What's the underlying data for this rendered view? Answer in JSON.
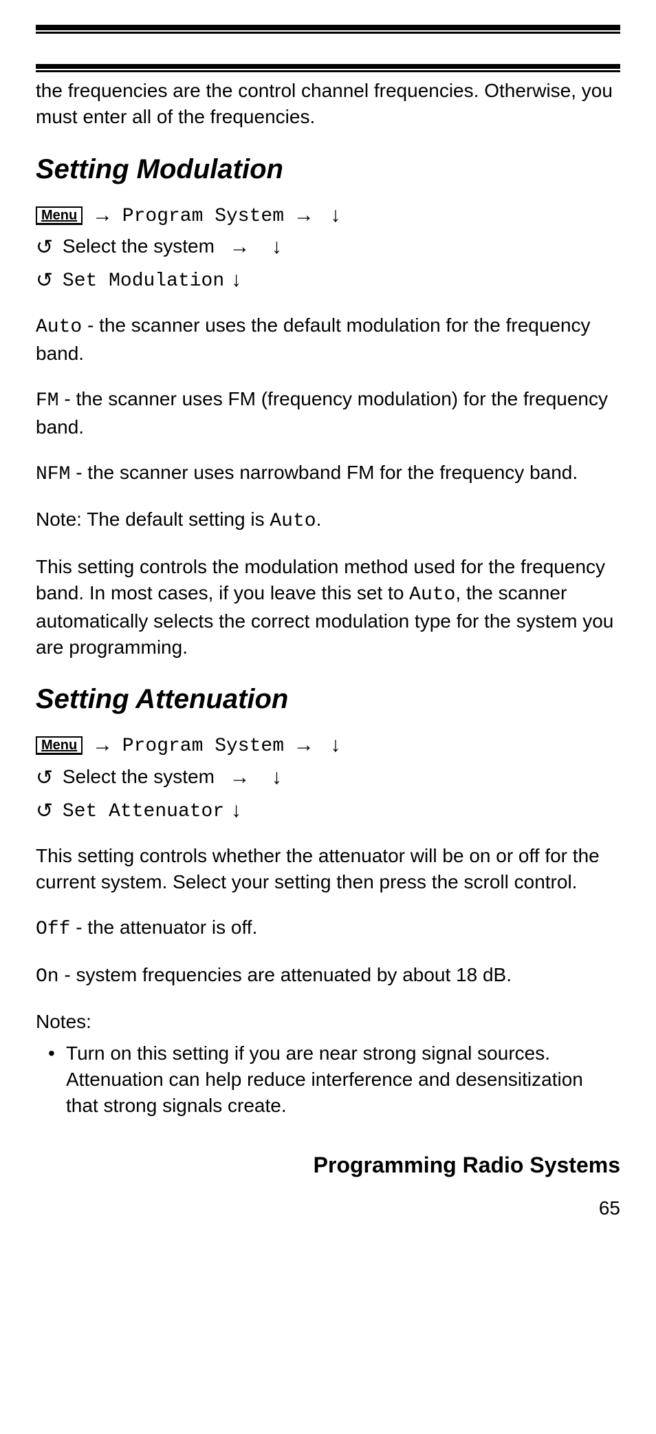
{
  "top_continuation": "the frequencies are the control channel frequencies. Otherwise, you must enter all of the frequencies.",
  "menu_key_label": "Menu",
  "sec_mod": {
    "title": "Setting Modulation",
    "nav1_text": "Program System",
    "nav2_text": "Select the system",
    "nav3_text": "Set Modulation",
    "auto_code": "Auto",
    "auto_desc": " - the scanner uses the default modulation for the frequency band.",
    "fm_code": "FM",
    "fm_desc": " - the scanner uses FM (frequency modulation) for the frequency band.",
    "nfm_code": "NFM",
    "nfm_desc": " - the scanner uses narrowband FM for the frequency band.",
    "note_prefix": "Note: The default setting is ",
    "note_code": "Auto",
    "note_suffix": ".",
    "expl_pre": "This setting controls the modulation method used for the frequency band. In most cases, if you leave this set to ",
    "expl_code": "Auto",
    "expl_post": ", the scanner automatically selects the correct modulation type for the system you are programming."
  },
  "sec_att": {
    "title": "Setting Attenuation",
    "nav1_text": "Program System",
    "nav2_text": "Select the system",
    "nav3_text": "Set Attenuator",
    "intro": "This setting controls whether the attenuator will be on or off for the current system. Select your setting then press the scroll control.",
    "off_code": "Off",
    "off_desc": " - the attenuator is off.",
    "on_code": "On",
    "on_desc": " - system frequencies are attenuated by about 18 dB.",
    "notes_label": "Notes:",
    "note1": "Turn on this setting if you are near strong signal sources. Attenuation can help reduce interference and desensitization that strong signals create."
  },
  "footer_title": "Programming Radio Systems",
  "page_number": "65"
}
